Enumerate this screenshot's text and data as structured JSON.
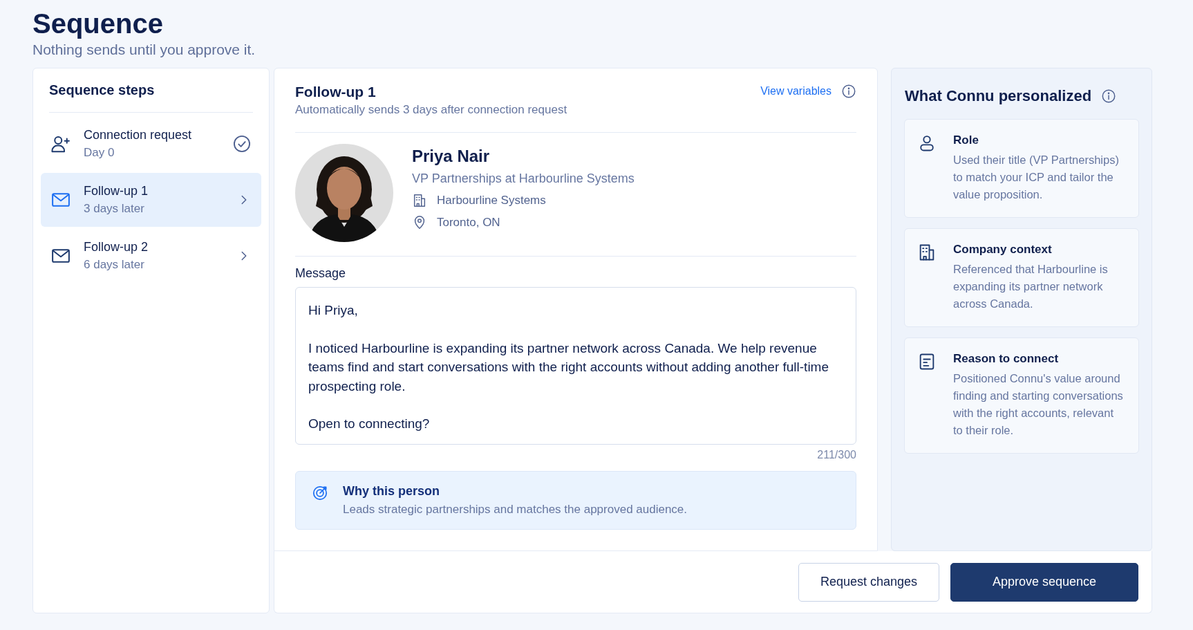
{
  "header": {
    "title": "Sequence",
    "subtitle": "Nothing sends until you approve it."
  },
  "steps_panel": {
    "title": "Sequence steps",
    "steps": [
      {
        "kind": "connect",
        "title": "Connection request",
        "subtitle": "Day 0",
        "selected": false,
        "done": true
      },
      {
        "kind": "email",
        "title": "Follow-up 1",
        "subtitle": "3 days later",
        "selected": true,
        "done": false
      },
      {
        "kind": "email",
        "title": "Follow-up 2",
        "subtitle": "6 days later",
        "selected": false,
        "done": false
      }
    ]
  },
  "editor": {
    "title": "Follow-up 1",
    "subtitle": "Automatically sends 3 days after connection request",
    "link": "View variables",
    "profile": {
      "name": "Priya Nair",
      "headline": "VP Partnerships at Harbourline Systems",
      "company": "Harbourline Systems",
      "location": "Toronto, ON"
    },
    "message": {
      "label": "Message",
      "paragraphs": [
        "Hi Priya,",
        "I noticed Harbourline is expanding its partner network across Canada. We help revenue teams find and start conversations with the right accounts without adding another full-time prospecting role.",
        "Open to connecting?"
      ],
      "counter": "211/300"
    },
    "why": {
      "title": "Why this person",
      "text": "Leads strategic partnerships and matches the approved audience."
    }
  },
  "personalized": {
    "title": "What Connu personalized",
    "items": [
      {
        "kind": "role",
        "title": "Role",
        "text": "Used their title (VP Partnerships) to match your ICP and tailor the value proposition."
      },
      {
        "kind": "company",
        "title": "Company context",
        "text": "Referenced that Harbourline is expanding its partner network across Canada."
      },
      {
        "kind": "reason",
        "title": "Reason to connect",
        "text": "Positioned Connu's value around finding and starting conversations with the right accounts, relevant to their role."
      }
    ]
  },
  "actions": [
    {
      "kind": "secondary",
      "label": "Request changes"
    },
    {
      "kind": "primary",
      "label": "Approve sequence"
    }
  ]
}
